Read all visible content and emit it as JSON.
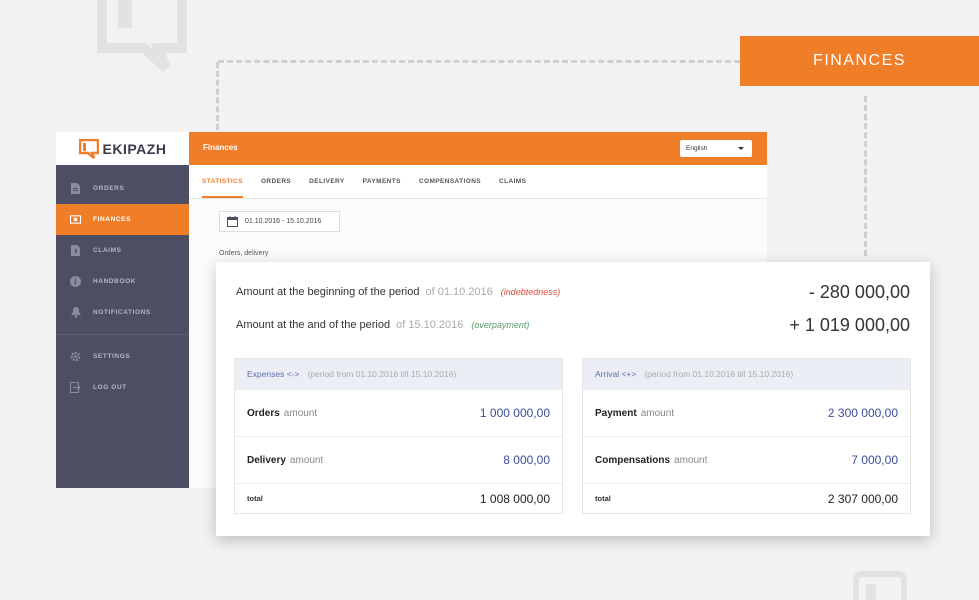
{
  "banner": {
    "label": "FINANCES"
  },
  "app": {
    "brand": "EKIPAZH",
    "page_title": "Finances",
    "language": "English"
  },
  "sidebar": {
    "items": [
      {
        "label": "ORDERS",
        "icon": "document-icon",
        "active": false
      },
      {
        "label": "FINANCES",
        "icon": "money-icon",
        "active": true
      },
      {
        "label": "CLAIMS",
        "icon": "claim-file-icon",
        "active": false
      },
      {
        "label": "HANDBOOK",
        "icon": "info-icon",
        "active": false
      },
      {
        "label": "NOTIFICATIONS",
        "icon": "bell-icon",
        "active": false
      },
      {
        "label": "SETTINGS",
        "icon": "gear-icon",
        "active": false
      },
      {
        "label": "LOG OUT",
        "icon": "logout-icon",
        "active": false
      }
    ]
  },
  "tabs": [
    {
      "label": "STATISTICS",
      "active": true
    },
    {
      "label": "ORDERS",
      "active": false
    },
    {
      "label": "DELIVERY",
      "active": false
    },
    {
      "label": "PAYMENTS",
      "active": false
    },
    {
      "label": "COMPENSATIONS",
      "active": false
    },
    {
      "label": "CLAIMS",
      "active": false
    }
  ],
  "filters": {
    "date_range": "01.10.2016 - 15.10.2016",
    "section_label": "Orders, delivery"
  },
  "summary": {
    "begin": {
      "label": "Amount at the beginning of the period",
      "date": "of 01.10.2016",
      "note": "(indebtedness)",
      "amount": "- 280 000,00"
    },
    "end": {
      "label": "Amount at the and of the period",
      "date": "of 15.10.2016",
      "note": "(overpayment)",
      "amount": "+ 1 019 000,00"
    }
  },
  "expenses": {
    "title": "Expenses <->",
    "period": "(period from 01.10.2016 till 15.10.2016)",
    "rows": [
      {
        "name": "Orders",
        "sub": "amount",
        "value": "1 000 000,00"
      },
      {
        "name": "Delivery",
        "sub": "amount",
        "value": "8 000,00"
      }
    ],
    "total_label": "total",
    "total_value": "1 008 000,00"
  },
  "arrival": {
    "title": "Arrival <+>",
    "period": "(period from 01.10.2016 till 15.10.2016)",
    "rows": [
      {
        "name": "Payment",
        "sub": "amount",
        "value": "2 300 000,00"
      },
      {
        "name": "Compensations",
        "sub": "amount",
        "value": "7 000,00"
      }
    ],
    "total_label": "total",
    "total_value": "2 307 000,00"
  },
  "colors": {
    "accent": "#f07d28",
    "sidebar": "#4d4e63",
    "value_blue": "#3a4f9c",
    "debt_red": "#e04a3a",
    "overpay_green": "#5a9a68"
  }
}
